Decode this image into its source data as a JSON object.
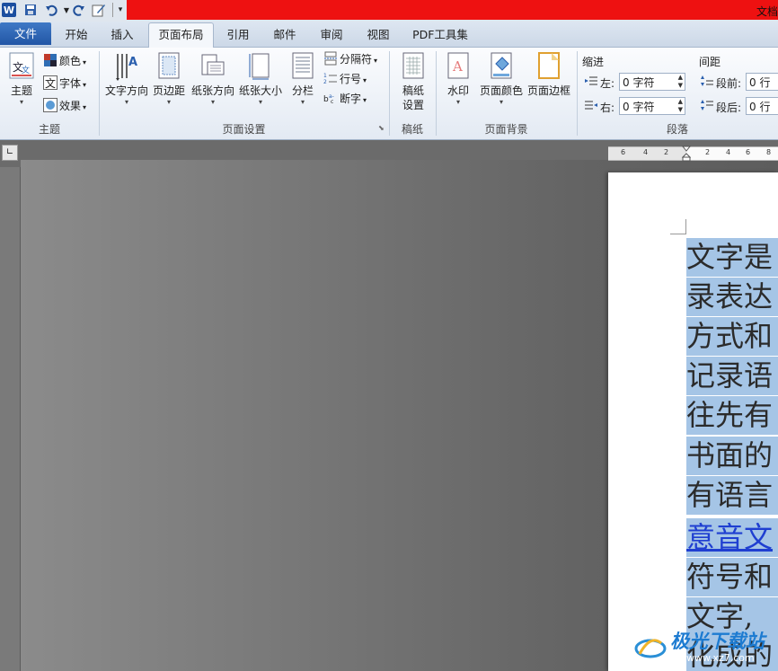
{
  "title_bar": {
    "title": "文档"
  },
  "tabs": [
    "文件",
    "开始",
    "插入",
    "页面布局",
    "引用",
    "邮件",
    "审阅",
    "视图",
    "PDF工具集"
  ],
  "groups": {
    "theme": {
      "label": "主题",
      "theme_button": "主题",
      "colors": "颜色",
      "fonts": "字体",
      "effects": "效果"
    },
    "page_setup": {
      "label": "页面设置",
      "text_direction": "文字方向",
      "margins": "页边距",
      "orientation": "纸张方向",
      "size": "纸张大小",
      "columns": "分栏",
      "breaks": "分隔符",
      "line_numbers": "行号",
      "hyphenation": "断字"
    },
    "draft_paper": {
      "label": "稿纸",
      "settings_line1": "稿纸",
      "settings_line2": "设置"
    },
    "page_background": {
      "label": "页面背景",
      "watermark": "水印",
      "page_color": "页面颜色",
      "page_borders": "页面边框"
    },
    "paragraph": {
      "label": "段落",
      "indent_label": "缩进",
      "spacing_label": "间距",
      "left_label": "左:",
      "left_value": "0 字符",
      "right_label": "右:",
      "right_value": "0 字符",
      "before_label": "段前:",
      "before_value": "0 行",
      "after_label": "段后:",
      "after_value": "0 行"
    }
  },
  "ruler": {
    "ticks": [
      "6",
      "4",
      "2",
      "2",
      "4",
      "6",
      "8"
    ]
  },
  "document": {
    "lines": [
      "文字是",
      "录表达",
      "方式和",
      "记录语",
      "往先有",
      "书面的",
      "有语言",
      "意音文",
      "符号和",
      "文字,",
      "化成的"
    ]
  },
  "watermark": {
    "brand": "极光下载站",
    "url": "www.xz7.com"
  },
  "colors": {
    "title_red": "#ee1111",
    "selection": "#a5c5e6",
    "file_tab": "#2a5fae"
  }
}
